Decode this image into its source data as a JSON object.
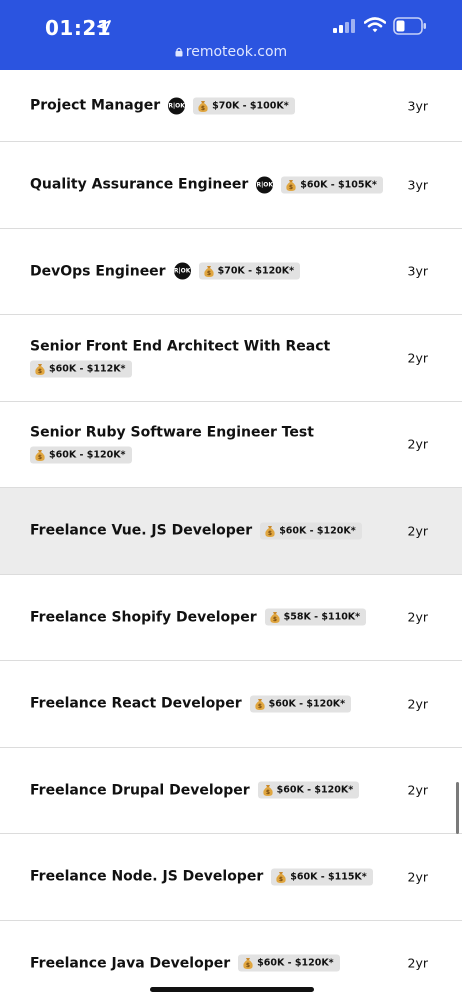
{
  "status_bar": {
    "time": "01:21",
    "icons": [
      "location-arrow-icon",
      "signal-icon",
      "wifi-icon",
      "battery-icon"
    ]
  },
  "browser": {
    "url": "remoteok.com"
  },
  "colors": {
    "top_bar": "#2b54e0",
    "highlight_row": "#ececec",
    "salary_badge": "#e2e2e2"
  },
  "jobs": [
    {
      "title": "Project Manager",
      "ok_badge": "R|OK",
      "salary": "$70K - $100K*",
      "age": "3yr"
    },
    {
      "title": "Quality Assurance Engineer",
      "ok_badge": "R|OK",
      "salary": "$60K - $105K*",
      "age": "3yr"
    },
    {
      "title": "DevOps Engineer",
      "ok_badge": "R|OK",
      "salary": "$70K - $120K*",
      "age": "3yr"
    },
    {
      "title": "Senior Front End Architect With React",
      "salary": "$60K - $112K*",
      "age": "2yr"
    },
    {
      "title": "Senior Ruby Software Engineer Test",
      "salary": "$60K - $120K*",
      "age": "2yr"
    },
    {
      "title": "Freelance Vue. JS Developer",
      "salary": "$60K - $120K*",
      "age": "2yr"
    },
    {
      "title": "Freelance Shopify Developer",
      "salary": "$58K - $110K*",
      "age": "2yr"
    },
    {
      "title": "Freelance React Developer",
      "salary": "$60K - $120K*",
      "age": "2yr"
    },
    {
      "title": "Freelance Drupal Developer",
      "salary": "$60K - $120K*",
      "age": "2yr"
    },
    {
      "title": "Freelance Node. JS Developer",
      "salary": "$60K - $115K*",
      "age": "2yr"
    },
    {
      "title": "Freelance Java Developer",
      "salary": "$60K - $120K*",
      "age": "2yr"
    }
  ]
}
